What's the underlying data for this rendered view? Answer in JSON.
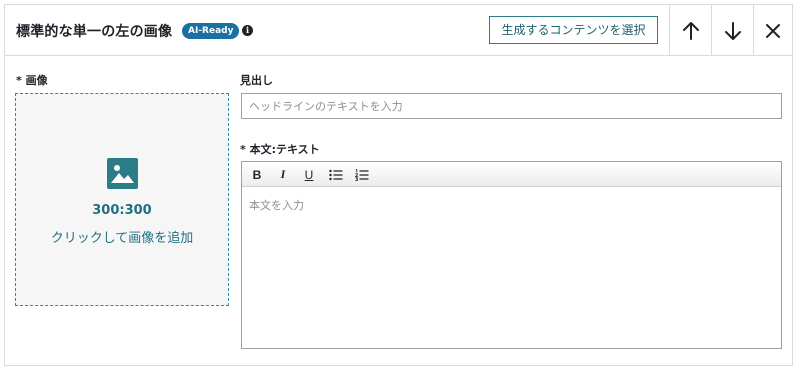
{
  "header": {
    "title": "標準的な単一の左の画像",
    "badge": "AI-Ready",
    "info_glyph": "i",
    "select_content_button": "生成するコンテンツを選択",
    "icons": [
      "arrow-up-icon",
      "arrow-down-icon",
      "close-icon"
    ]
  },
  "image_field": {
    "label": "* 画像",
    "size": "300:300",
    "hint": "クリックして画像を追加",
    "icon": "image-icon"
  },
  "headline_field": {
    "label": "見出し",
    "placeholder": "ヘッドラインのテキストを入力",
    "value": ""
  },
  "body_field": {
    "label": "* 本文:テキスト",
    "placeholder": "本文を入力",
    "toolbar": {
      "bold": "B",
      "italic": "I",
      "underline": "U",
      "icons": [
        "bulleted-list-icon",
        "numbered-list-icon"
      ]
    }
  },
  "colors": {
    "accent": "#1a6fa3",
    "teal": "#2b7c86",
    "image_icon": "#2b7c86",
    "border": "#d8dadd"
  }
}
